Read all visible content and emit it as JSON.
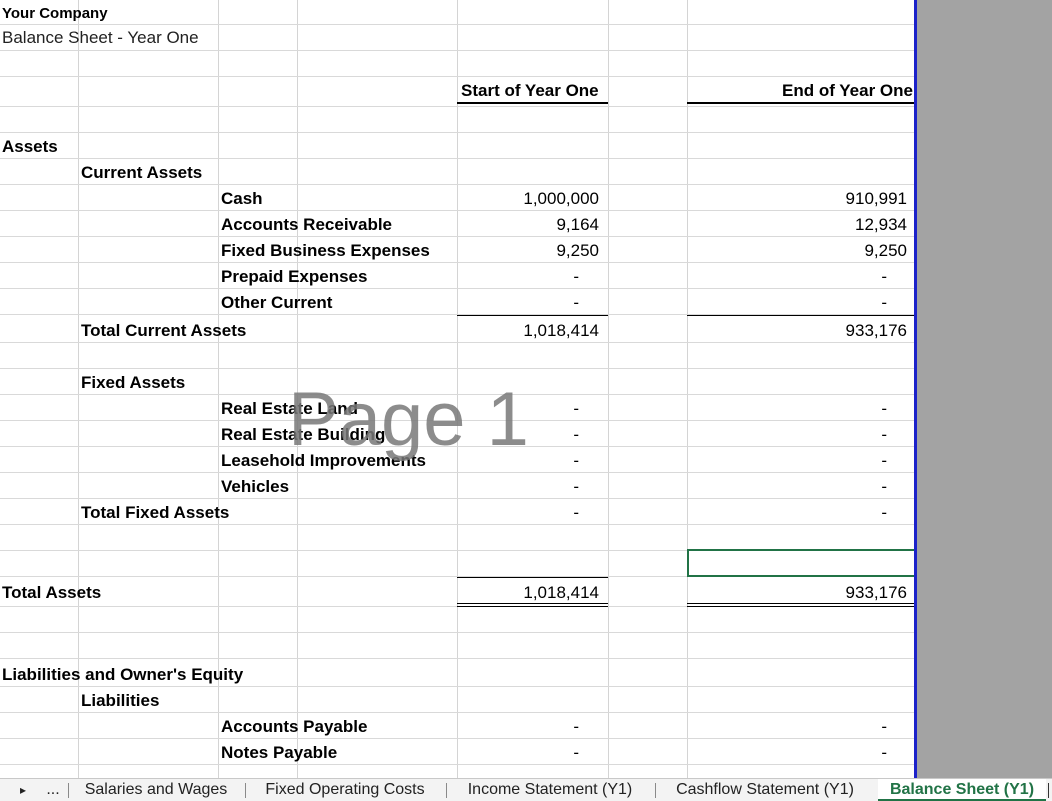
{
  "company": "Your Company",
  "subtitle": "Balance Sheet - Year One",
  "columns": {
    "start": "Start of Year One",
    "end": "End of Year One"
  },
  "assets": {
    "label": "Assets",
    "current": {
      "label": "Current Assets",
      "rows": [
        {
          "label": "Cash",
          "start": "1,000,000",
          "end": "910,991"
        },
        {
          "label": "Accounts Receivable",
          "start": "9,164",
          "end": "12,934"
        },
        {
          "label": "Fixed Business Expenses",
          "start": "9,250",
          "end": "9,250"
        },
        {
          "label": "Prepaid Expenses",
          "start": "-",
          "end": "-"
        },
        {
          "label": "Other Current",
          "start": "-",
          "end": "-"
        }
      ],
      "total_label": "Total Current Assets",
      "total_start": "1,018,414",
      "total_end": "933,176"
    },
    "fixed": {
      "label": "Fixed Assets",
      "rows": [
        {
          "label": "Real Estate Land",
          "start": "-",
          "end": "-"
        },
        {
          "label": "Real Estate Building",
          "start": "-",
          "end": "-"
        },
        {
          "label": "Leasehold Improvements",
          "start": "-",
          "end": "-"
        },
        {
          "label": "Vehicles",
          "start": "-",
          "end": "-"
        }
      ],
      "total_label": "Total Fixed Assets",
      "total_start": "-",
      "total_end": "-"
    },
    "total_label": "Total Assets",
    "total_start": "1,018,414",
    "total_end": "933,176"
  },
  "liabilities_equity": {
    "label": "Liabilities and Owner's Equity",
    "liabilities_label": "Liabilities",
    "rows": [
      {
        "label": "Accounts Payable",
        "start": "-",
        "end": "-"
      },
      {
        "label": "Notes Payable",
        "start": "-",
        "end": "-"
      }
    ]
  },
  "watermark": "Page 1",
  "tabs": {
    "nav_arrow": "▸",
    "overflow": "...",
    "items": [
      "Salaries and Wages",
      "Fixed Operating Costs",
      "Income Statement (Y1)",
      "Cashflow Statement (Y1)",
      "Balance Sheet (Y1)"
    ],
    "active": "Balance Sheet (Y1)"
  },
  "colors": {
    "accent": "#217346",
    "page_break": "#1c22c9",
    "gray_area": "#a3a3a3"
  }
}
